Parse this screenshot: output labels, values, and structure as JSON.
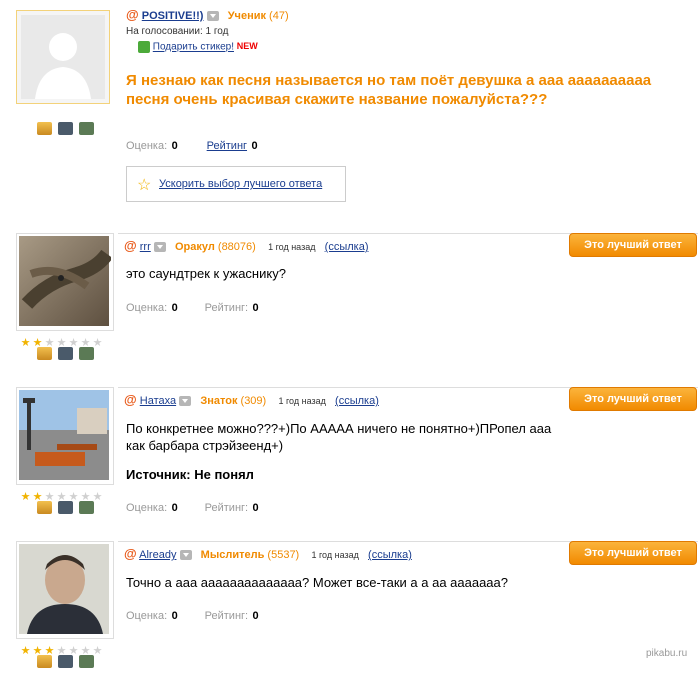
{
  "question": {
    "author": "POSITIVE!!)",
    "rank": "Ученик",
    "points": "(47)",
    "voting": "На голосовании: 1 год",
    "sticker_link": "Подарить стикер!",
    "new_badge": "NEW",
    "text": "Я незнаю как песня называется но там поёт девушка а ааа ааааааааaa песня очень красивая скажите название пожалуйста???",
    "rating_label": "Оценка:",
    "rating_value": "0",
    "rating2_label": "Рейтинг",
    "rating2_value": "0",
    "speed_link": "Ускорить выбор лучшего ответа"
  },
  "answers": [
    {
      "author": "rrr",
      "rank": "Оракул",
      "points": "(88076)",
      "time": "1 год назад",
      "link": "(ссылка)",
      "best_label": "Это лучший ответ",
      "text": "это саундтрек к ужаснику?",
      "rating_label": "Оценка:",
      "rating_value": "0",
      "rating2_label": "Рейтинг:",
      "rating2_value": "0",
      "stars": 2
    },
    {
      "author": "Натаха",
      "rank": "Знаток",
      "points": "(309)",
      "time": "1 год назад",
      "link": "(ссылка)",
      "best_label": "Это лучший ответ",
      "text": "По конкретнее можно???+)По ААААА ничего не понятно+)ПРопел ааа как барбара стрэйзеенд+)",
      "source": "Источник: Не понял",
      "rating_label": "Оценка:",
      "rating_value": "0",
      "rating2_label": "Рейтинг:",
      "rating2_value": "0",
      "stars": 2
    },
    {
      "author": "Already",
      "rank": "Мыслитель",
      "points": "(5537)",
      "time": "1 год назад",
      "link": "(ссылка)",
      "best_label": "Это лучший ответ",
      "text": "Точно а ааа аааааааааааааа? Может все-таки а а аа ааааааа?",
      "rating_label": "Оценка:",
      "rating_value": "0",
      "rating2_label": "Рейтинг:",
      "rating2_value": "0",
      "stars": 3
    }
  ],
  "watermark": "pikabu.ru"
}
